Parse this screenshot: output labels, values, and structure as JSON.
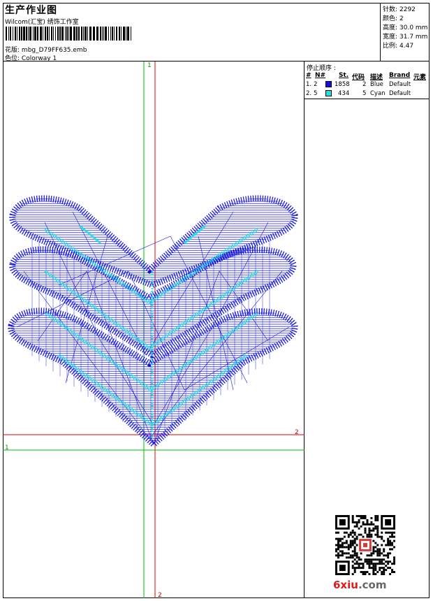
{
  "header": {
    "title": "生产作业图",
    "studio": "Wilcom(汇宝) 绣饰工作室",
    "design_label": "花版:",
    "design_value": "mbg_D79FF635.emb",
    "colorway_label": "色位:",
    "colorway_value": "Colorway 1"
  },
  "stats": [
    {
      "label": "针数:",
      "value": "2292"
    },
    {
      "label": "颜色:",
      "value": "2"
    },
    {
      "label": "高度:",
      "value": "30.0 mm"
    },
    {
      "label": "宽度:",
      "value": "31.7 mm"
    },
    {
      "label": "比例:",
      "value": "4.47"
    }
  ],
  "canvas": {
    "axis_label_top": "1",
    "axis_label_left": "1",
    "axis_label_right": "2",
    "axis_label_bottom": "2"
  },
  "stop_panel": {
    "title": "停止顺序 :",
    "headers": [
      "#",
      "N#",
      "St.",
      "代码",
      "描述",
      "Brand",
      "元素"
    ],
    "rows": [
      {
        "idx": "1.",
        "n": "2",
        "color": "#1010e0",
        "st": "1858",
        "code": "2",
        "desc": "Blue",
        "brand": "Default",
        "elem": ""
      },
      {
        "idx": "2.",
        "n": "5",
        "color": "#20e0e0",
        "st": "434",
        "code": "5",
        "desc": "Cyan",
        "brand": "Default",
        "elem": ""
      }
    ]
  },
  "colors": {
    "blue_thread": "#1010e0",
    "cyan_thread": "#20e0e0",
    "guide_green": "#00c000",
    "guide_red": "#e00000"
  },
  "watermark": {
    "part1": "6xiu",
    "part2": ".com"
  }
}
